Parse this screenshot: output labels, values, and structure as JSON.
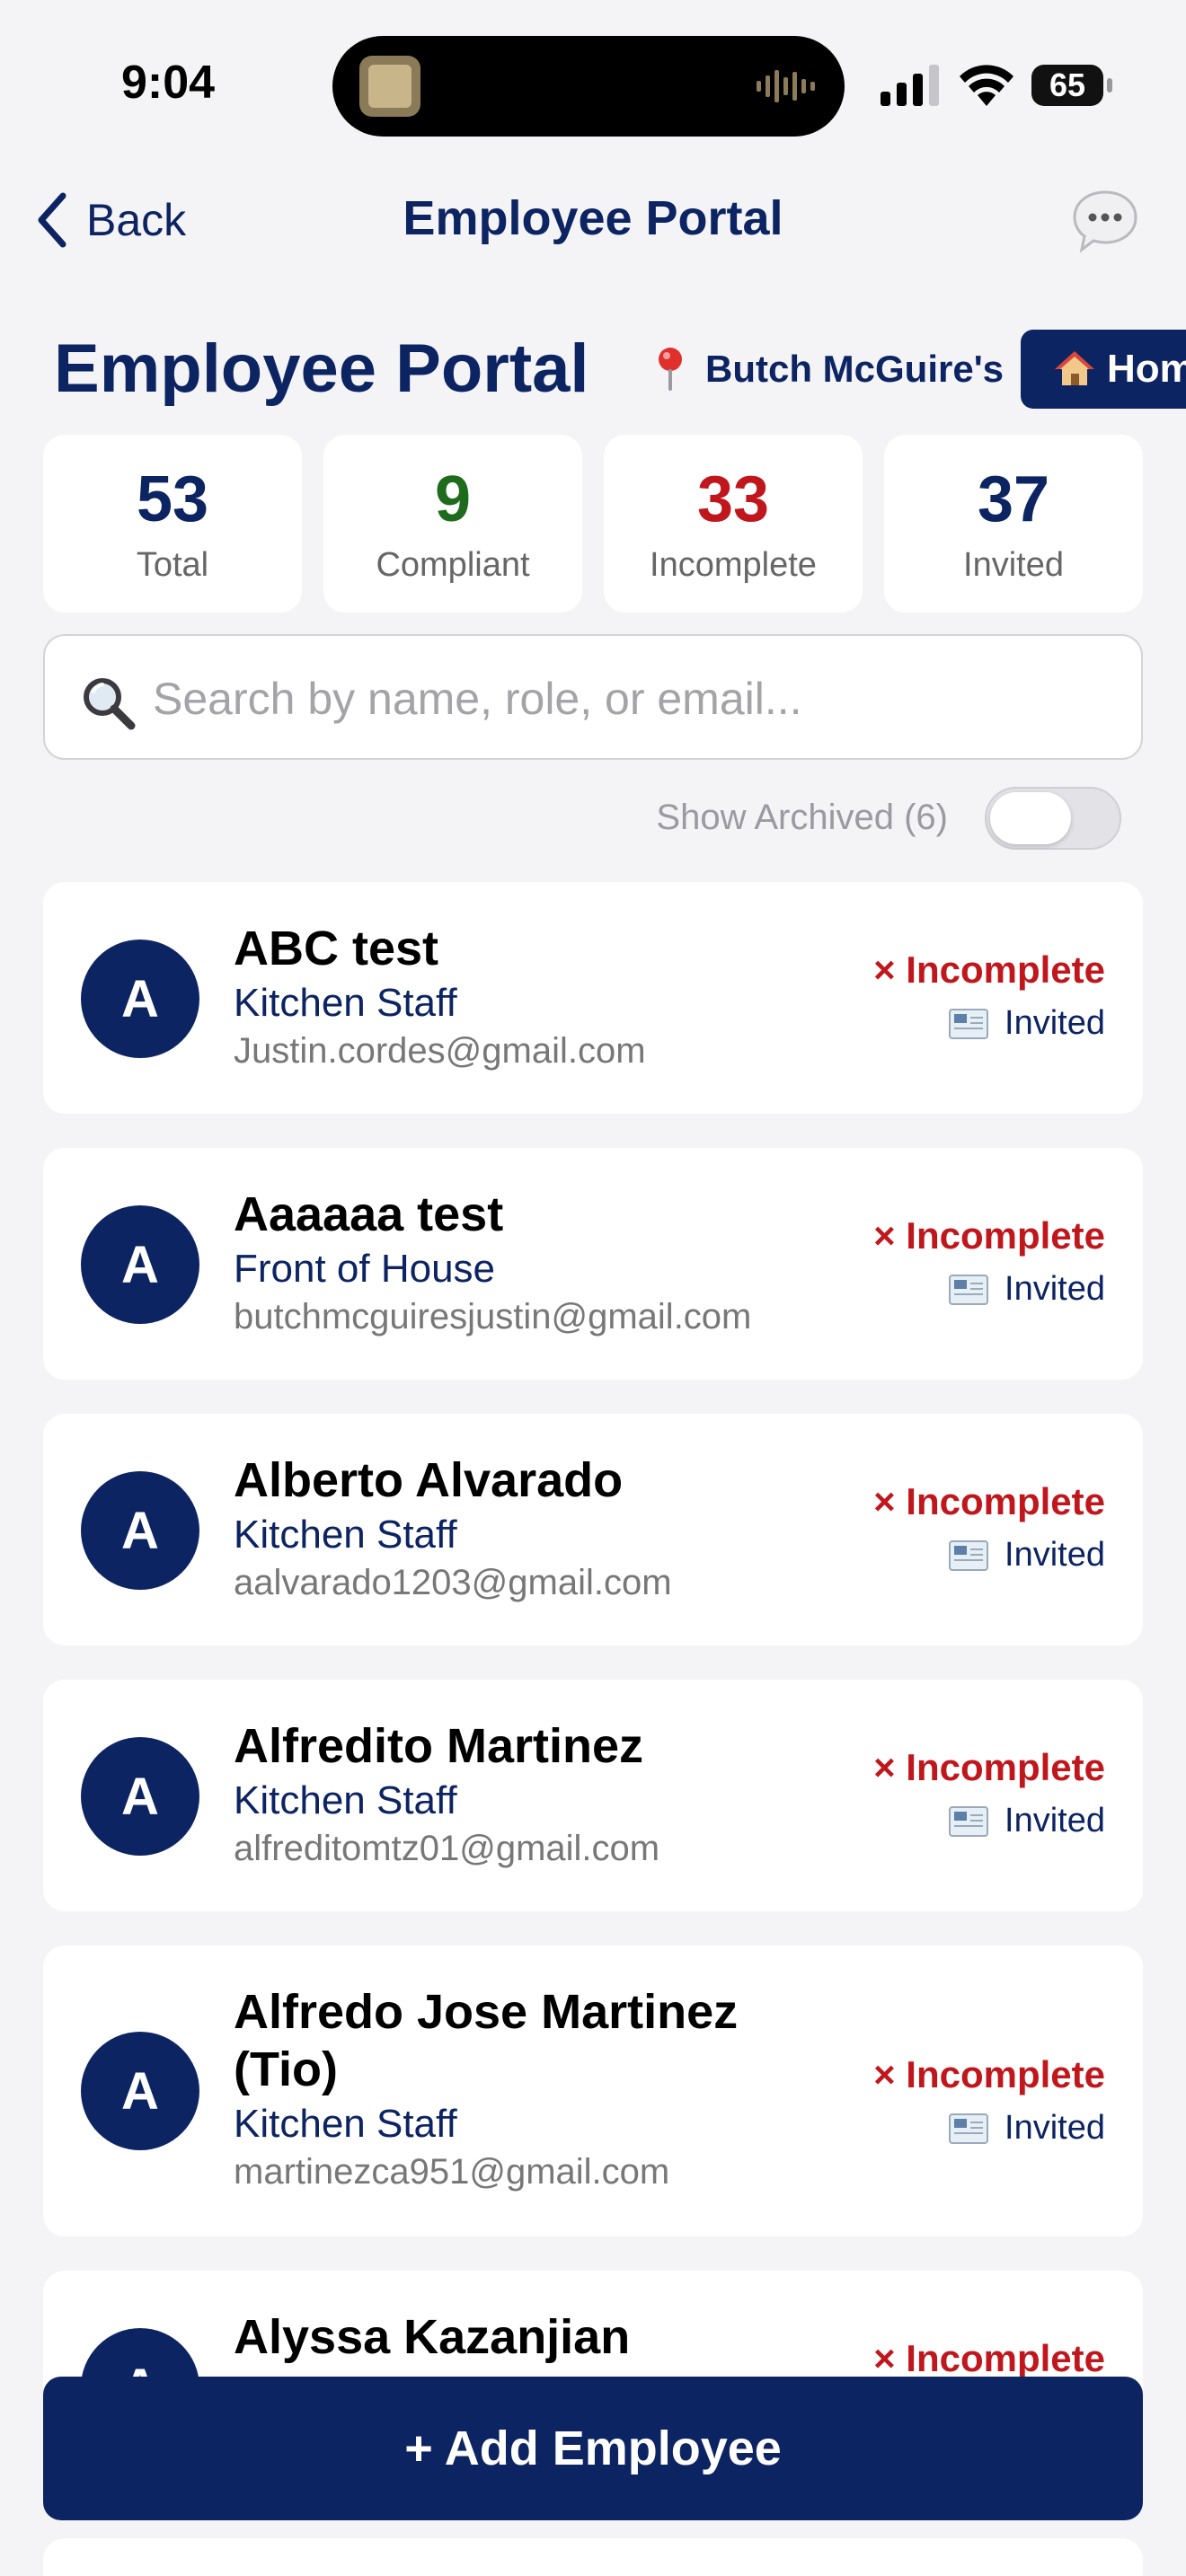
{
  "status_bar": {
    "time": "9:04",
    "battery": "65"
  },
  "nav": {
    "back_label": "Back",
    "title": "Employee Portal"
  },
  "header": {
    "title": "Employee Portal",
    "location": "Butch McGuire's",
    "home_label": "Hom"
  },
  "stats": [
    {
      "value": "53",
      "label": "Total",
      "color": "#0d2463"
    },
    {
      "value": "9",
      "label": "Compliant",
      "color": "#1e6b1e"
    },
    {
      "value": "33",
      "label": "Incomplete",
      "color": "#c0171d"
    },
    {
      "value": "37",
      "label": "Invited",
      "color": "#0d2463"
    }
  ],
  "search": {
    "placeholder": "Search by name, role, or email..."
  },
  "archived": {
    "label": "Show Archived (6)",
    "enabled": false
  },
  "employees": [
    {
      "initial": "A",
      "name": "ABC test",
      "role": "Kitchen Staff",
      "email": "Justin.cordes@gmail.com",
      "status": "× Incomplete",
      "invite": "Invited"
    },
    {
      "initial": "A",
      "name": "Aaaaaa test",
      "role": "Front of House",
      "email": "butchmcguiresjustin@gmail.com",
      "status": "× Incomplete",
      "invite": "Invited"
    },
    {
      "initial": "A",
      "name": "Alberto Alvarado",
      "role": "Kitchen Staff",
      "email": "aalvarado1203@gmail.com",
      "status": "× Incomplete",
      "invite": "Invited"
    },
    {
      "initial": "A",
      "name": "Alfredito Martinez",
      "role": "Kitchen Staff",
      "email": "alfreditomtz01@gmail.com",
      "status": "× Incomplete",
      "invite": "Invited"
    },
    {
      "initial": "A",
      "name": "Alfredo Jose Martinez (Tio)",
      "role": "Kitchen Staff",
      "email": "martinezca951@gmail.com",
      "status": "× Incomplete",
      "invite": "Invited"
    },
    {
      "initial": "A",
      "name": "Alyssa Kazanjian",
      "role": "",
      "email": "",
      "status": "× Incomplete",
      "invite": ""
    }
  ],
  "add_button": {
    "label": "+ Add Employee"
  },
  "colors": {
    "navy": "#0d2463",
    "red": "#c0171d",
    "green": "#1e6b1e",
    "background": "#f4f4f6"
  }
}
